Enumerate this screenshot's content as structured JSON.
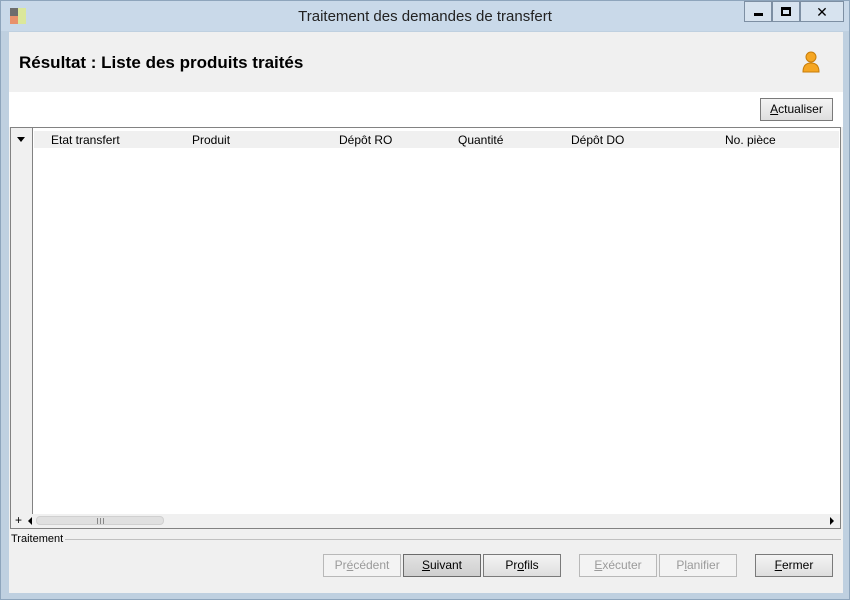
{
  "window": {
    "title": "Traitement des demandes de transfert"
  },
  "header": {
    "title": "Résultat : Liste des produits traités"
  },
  "toolbar": {
    "refresh": {
      "pre": "",
      "key": "A",
      "post": "ctualiser"
    }
  },
  "grid": {
    "columns": [
      "Etat transfert",
      "Produit",
      "Dépôt RO",
      "Quantité",
      "Dépôt DO",
      "No. pièce"
    ],
    "rows": [],
    "add_symbol": "+"
  },
  "group": {
    "label": "Traitement"
  },
  "footer": {
    "prev": {
      "pre": "Pr",
      "key": "é",
      "post": "cédent",
      "enabled": false
    },
    "next": {
      "pre": "",
      "key": "S",
      "post": "uivant",
      "enabled": true
    },
    "profiles": {
      "pre": "Pr",
      "key": "o",
      "post": "fils",
      "enabled": true
    },
    "execute": {
      "pre": "",
      "key": "E",
      "post": "xécuter",
      "enabled": false
    },
    "plan": {
      "pre": "P",
      "key": "l",
      "post": "anifier",
      "enabled": false
    },
    "close": {
      "pre": "",
      "key": "F",
      "post": "ermer",
      "enabled": true
    }
  },
  "icons": {
    "app": "app-icon",
    "user": "user-icon",
    "minimize": "minimize-icon",
    "maximize": "maximize-icon",
    "close": "close-icon"
  },
  "colors": {
    "titlebar": "#c9d9e9",
    "client": "#f0f0f0",
    "user_icon": "#f5a623"
  }
}
